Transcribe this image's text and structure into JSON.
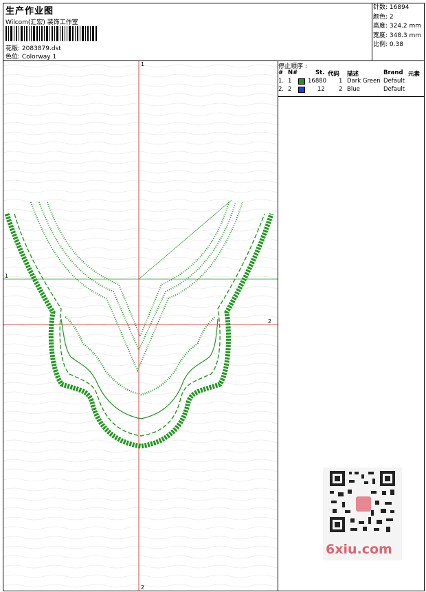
{
  "header": {
    "title": "生产作业图",
    "company": "Wilcom(汇宏) 装饰工作室",
    "design_label": "花版: 2083879.dst",
    "colorway_label": "色位: Colorway 1"
  },
  "stats": [
    {
      "label": "针数: 16894"
    },
    {
      "label": "颜色: 2"
    },
    {
      "label": "高度: 324.2 mm"
    },
    {
      "label": "宽度: 348.3 mm"
    },
    {
      "label": "比例: 0.38"
    }
  ],
  "stop_sequence": {
    "title": "停止顺序 :",
    "columns": [
      "#",
      "N#",
      "St.",
      "代码",
      "描述",
      "Brand",
      "元素"
    ],
    "rows": [
      {
        "index": "1.",
        "n": "1",
        "color": "#1a9a1a",
        "stitches": "16880",
        "code": "1",
        "description": "Dark Green",
        "brand": "Default"
      },
      {
        "index": "2.",
        "n": "2",
        "color": "#1a3cff",
        "stitches": "12",
        "code": "2",
        "description": "Blue",
        "brand": "Default"
      }
    ]
  },
  "axes": {
    "top": "1",
    "bottom": "2",
    "left": "1",
    "right": "2"
  },
  "watermark": {
    "text": "6xiu.com"
  }
}
